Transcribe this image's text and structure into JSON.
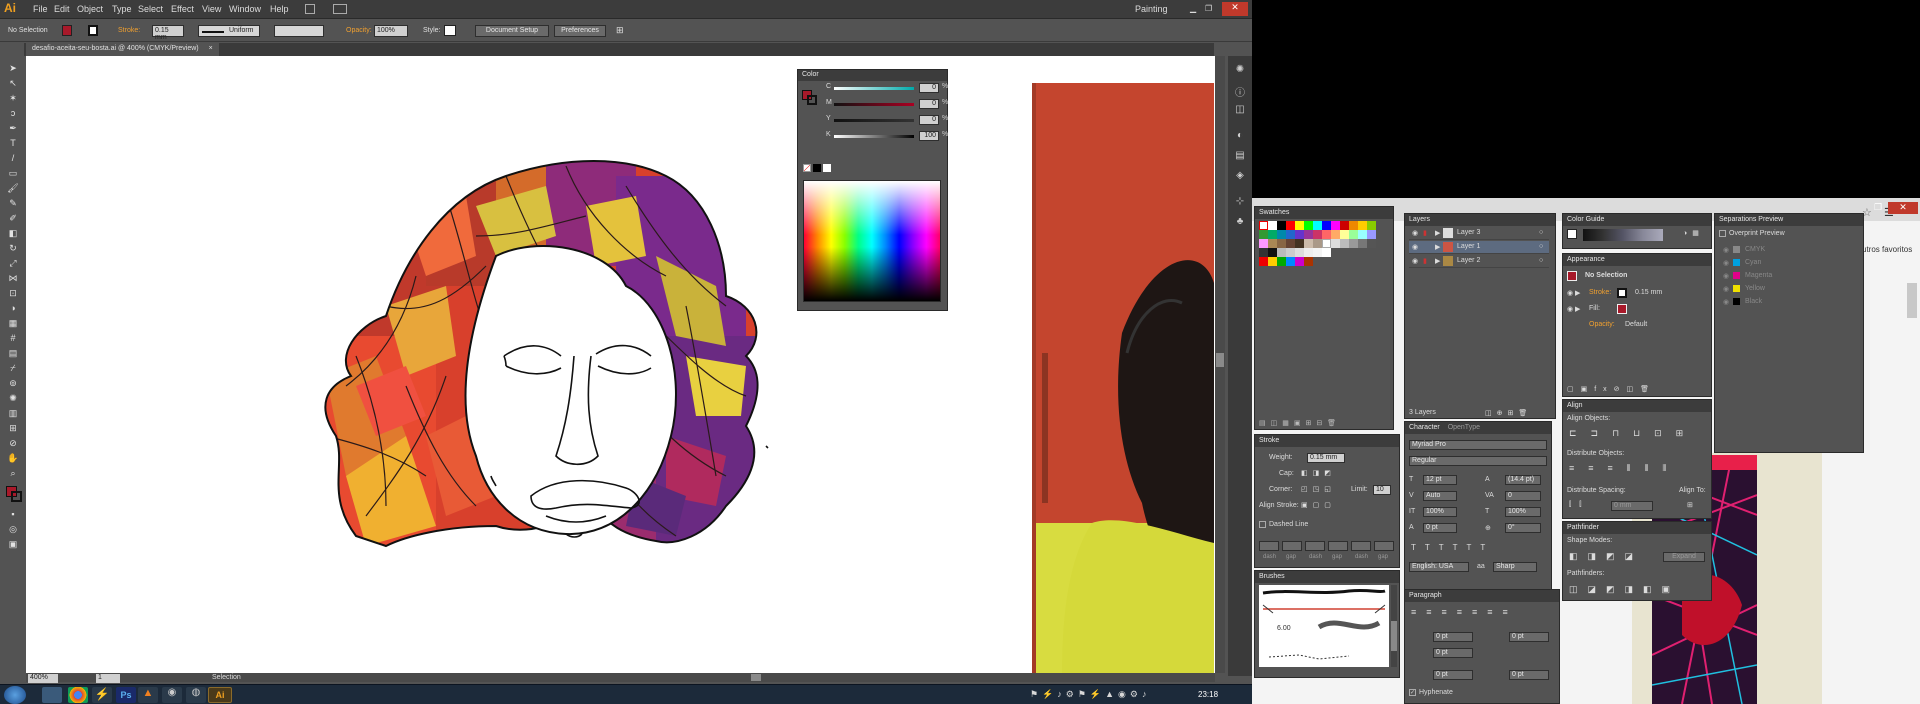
{
  "app": {
    "logo": "Ai",
    "workspace": "Painting"
  },
  "menu": [
    "File",
    "Edit",
    "Object",
    "Type",
    "Select",
    "Effect",
    "View",
    "Window",
    "Help"
  ],
  "control_bar": {
    "selection": "No Selection",
    "stroke_label": "Stroke:",
    "stroke_value": "0.15 mm",
    "stroke_style": "Uniform",
    "opacity_label": "Opacity:",
    "opacity_value": "100%",
    "style_label": "Style:",
    "document_setup": "Document Setup",
    "preferences": "Preferences"
  },
  "document": {
    "tab_title": "desafio-aceita-seu-bosta.ai @ 400% (CMYK/Preview)"
  },
  "status": {
    "zoom": "400%",
    "page": "1",
    "tool": "Selection"
  },
  "color_panel": {
    "title": "Color",
    "sliders": [
      {
        "label": "C",
        "value": "0"
      },
      {
        "label": "M",
        "value": "0"
      },
      {
        "label": "Y",
        "value": "0"
      },
      {
        "label": "K",
        "value": "100"
      }
    ],
    "unit": "%"
  },
  "swatches": {
    "title": "Swatches"
  },
  "layers": {
    "title": "Layers",
    "items": [
      {
        "name": "Layer 3"
      },
      {
        "name": "Layer 1"
      },
      {
        "name": "Layer 2"
      }
    ],
    "count": "3 Layers"
  },
  "stroke_panel": {
    "title": "Stroke",
    "weight_label": "Weight:",
    "weight": "0.15 mm",
    "cap_label": "Cap:",
    "corner_label": "Corner:",
    "limit_label": "Limit:",
    "limit": "10",
    "align_label": "Align Stroke:",
    "dashed": "Dashed Line",
    "dash_labels": [
      "dash",
      "gap",
      "dash",
      "gap",
      "dash",
      "gap"
    ]
  },
  "brushes": {
    "title": "Brushes",
    "size": "6.00"
  },
  "character": {
    "tabs": [
      "Character",
      "OpenType"
    ],
    "font": "Myriad Pro",
    "style": "Regular",
    "size": "12 pt",
    "leading": "(14.4 pt)",
    "kerning": "Auto",
    "tracking": "0",
    "vscale": "100%",
    "hscale": "100%",
    "baseline": "0 pt",
    "rotation": "0°",
    "language": "English: USA",
    "aa": "Sharp"
  },
  "paragraph": {
    "title": "Paragraph",
    "fields": [
      "0 pt",
      "0 pt",
      "0 pt",
      "0 pt",
      "0 pt"
    ],
    "hyphenate": "Hyphenate"
  },
  "color_guide": {
    "title": "Color Guide"
  },
  "appearance": {
    "title": "Appearance",
    "selection": "No Selection",
    "stroke_label": "Stroke:",
    "stroke_value": "0.15 mm",
    "fill_label": "Fill:",
    "opacity_label": "Opacity:",
    "opacity_value": "Default"
  },
  "align": {
    "title": "Align",
    "align_objects": "Align Objects:",
    "distribute_objects": "Distribute Objects:",
    "distribute_spacing": "Distribute Spacing:",
    "align_to": "Align To:",
    "spacing_value": "0 mm"
  },
  "pathfinder": {
    "title": "Pathfinder",
    "shape_modes": "Shape Modes:",
    "expand": "Expand",
    "pathfinders": "Pathfinders:"
  },
  "separations": {
    "title": "Separations Preview",
    "overprint": "Overprint Preview",
    "inks": [
      {
        "name": "CMYK",
        "color": "#888888"
      },
      {
        "name": "Cyan",
        "color": "#00a0e0"
      },
      {
        "name": "Magenta",
        "color": "#e0008a"
      },
      {
        "name": "Yellow",
        "color": "#f0e000"
      },
      {
        "name": "Black",
        "color": "#000000"
      }
    ]
  },
  "browser": {
    "link_text": "utros favoritos"
  },
  "taskbar": {
    "clock": "23:18"
  }
}
